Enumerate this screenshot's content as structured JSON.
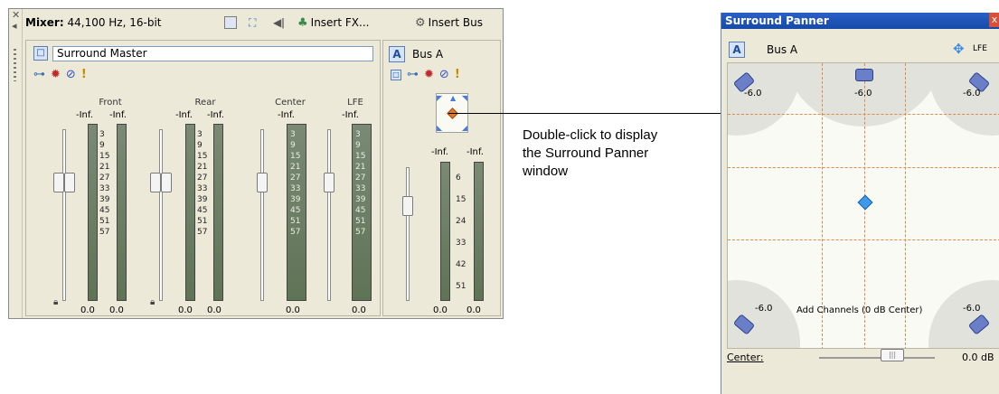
{
  "mixer": {
    "title_bold": "Mixer:",
    "title_rest": "44,100 Hz, 16-bit",
    "toolbar": {
      "insert_fx": "Insert FX...",
      "insert_bus": "Insert Bus"
    },
    "master": {
      "name": "Surround Master",
      "channels": [
        {
          "label": "Front",
          "peaks": [
            "-Inf.",
            "-Inf."
          ],
          "values": [
            "0.0",
            "0.0"
          ]
        },
        {
          "label": "Rear",
          "peaks": [
            "-Inf.",
            "-Inf."
          ],
          "values": [
            "0.0",
            "0.0"
          ]
        },
        {
          "label": "Center",
          "peaks": [
            "-Inf."
          ],
          "values": [
            "0.0"
          ]
        },
        {
          "label": "LFE",
          "peaks": [
            "-Inf."
          ],
          "values": [
            "0.0"
          ]
        }
      ],
      "scale": [
        "3",
        "9",
        "15",
        "21",
        "27",
        "33",
        "39",
        "45",
        "51",
        "57"
      ]
    },
    "bus": {
      "badge": "A",
      "name": "Bus A",
      "peaks": [
        "-Inf.",
        "-Inf."
      ],
      "values": [
        "0.0",
        "0.0"
      ],
      "scale": [
        "6",
        "15",
        "24",
        "33",
        "42",
        "51"
      ]
    }
  },
  "callout": {
    "text_line1": "Double-click to display",
    "text_line2": "the Surround Panner",
    "text_line3": "window"
  },
  "panner": {
    "title": "Surround Panner",
    "close": "x",
    "badge": "A",
    "bus_name": "Bus A",
    "lfe": "LFE",
    "speaker_db": [
      "-6.0",
      "-6.0",
      "-6.0",
      "-6.0",
      "-6.0"
    ],
    "add_channels": "Add Channels (0 dB Center)",
    "center_label": "Center:",
    "center_value": "0.0 dB"
  },
  "colors": {
    "panel_bg": "#ece9d8",
    "title_bar": "#2a5fc6",
    "grid_dash": "#e08a4a",
    "pan_point": "#3d9be8"
  }
}
